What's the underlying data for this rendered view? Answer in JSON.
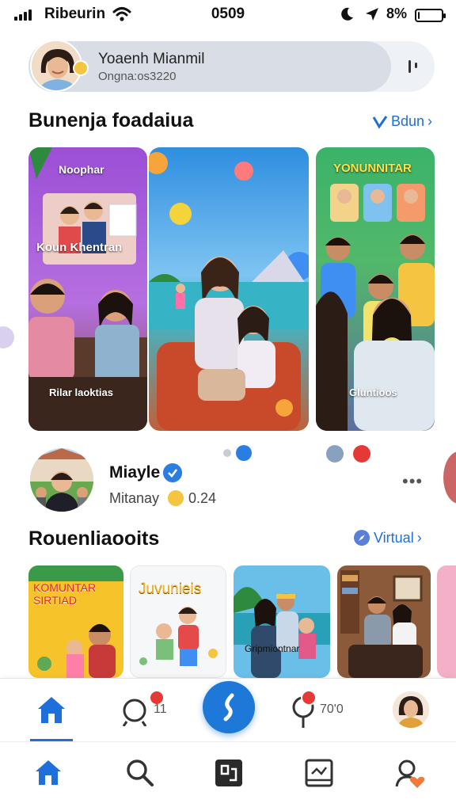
{
  "status": {
    "carrier": "Ribeurin",
    "time": "0509",
    "battery": "8%",
    "battery_level": 0.08
  },
  "profile": {
    "name": "Yoaenh Mianmil",
    "handle": "Ongna:os3220"
  },
  "featured": {
    "title": "Bunenja foadaiua",
    "link": "Bdun",
    "cards": [
      {
        "tag": "Noophar",
        "caption": "Koun Khentran",
        "footer": "Rilar laoktias"
      },
      {
        "tag": "",
        "caption": "",
        "footer": ""
      },
      {
        "tag": "YONUNNITAR",
        "caption": "",
        "footer": "Gluntioos"
      }
    ]
  },
  "creator": {
    "name": "Miayle",
    "subtitle": "Mitanay",
    "count": "0.24"
  },
  "recommended": {
    "title": "Rouenliaooits",
    "link": "Virtual",
    "thumbs": [
      {
        "caption": "KOMUNTAR SIRTIAD"
      },
      {
        "caption": "Juvunieis"
      },
      {
        "caption": "Gripmiontnar"
      },
      {
        "caption": ""
      }
    ]
  },
  "nav_top": {
    "items": [
      {
        "icon": "home-icon"
      },
      {
        "icon": "notification-icon",
        "count": "11"
      },
      {
        "icon": "create-icon"
      },
      {
        "icon": "location-pin-icon",
        "count": "70'0"
      },
      {
        "icon": "avatar"
      }
    ]
  },
  "nav_bottom": {
    "items": [
      {
        "icon": "home-icon"
      },
      {
        "icon": "search-icon"
      },
      {
        "icon": "studio-icon"
      },
      {
        "icon": "image-icon"
      },
      {
        "icon": "profile-heart-icon"
      }
    ]
  },
  "colors": {
    "accent": "#1e6fd9",
    "badge": "#e53935",
    "verified": "#2a7de1"
  }
}
